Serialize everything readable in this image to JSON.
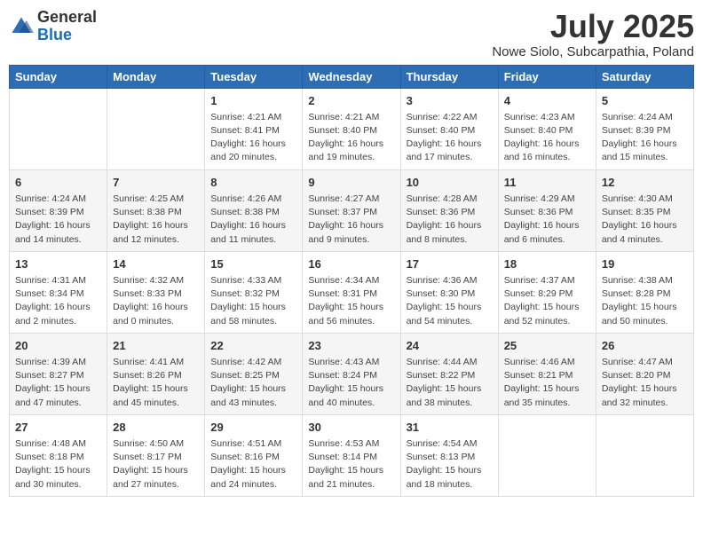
{
  "header": {
    "logo_general": "General",
    "logo_blue": "Blue",
    "month_title": "July 2025",
    "location": "Nowe Siolo, Subcarpathia, Poland"
  },
  "days_of_week": [
    "Sunday",
    "Monday",
    "Tuesday",
    "Wednesday",
    "Thursday",
    "Friday",
    "Saturday"
  ],
  "weeks": [
    [
      {
        "day": "",
        "info": ""
      },
      {
        "day": "",
        "info": ""
      },
      {
        "day": "1",
        "info": "Sunrise: 4:21 AM\nSunset: 8:41 PM\nDaylight: 16 hours and 20 minutes."
      },
      {
        "day": "2",
        "info": "Sunrise: 4:21 AM\nSunset: 8:40 PM\nDaylight: 16 hours and 19 minutes."
      },
      {
        "day": "3",
        "info": "Sunrise: 4:22 AM\nSunset: 8:40 PM\nDaylight: 16 hours and 17 minutes."
      },
      {
        "day": "4",
        "info": "Sunrise: 4:23 AM\nSunset: 8:40 PM\nDaylight: 16 hours and 16 minutes."
      },
      {
        "day": "5",
        "info": "Sunrise: 4:24 AM\nSunset: 8:39 PM\nDaylight: 16 hours and 15 minutes."
      }
    ],
    [
      {
        "day": "6",
        "info": "Sunrise: 4:24 AM\nSunset: 8:39 PM\nDaylight: 16 hours and 14 minutes."
      },
      {
        "day": "7",
        "info": "Sunrise: 4:25 AM\nSunset: 8:38 PM\nDaylight: 16 hours and 12 minutes."
      },
      {
        "day": "8",
        "info": "Sunrise: 4:26 AM\nSunset: 8:38 PM\nDaylight: 16 hours and 11 minutes."
      },
      {
        "day": "9",
        "info": "Sunrise: 4:27 AM\nSunset: 8:37 PM\nDaylight: 16 hours and 9 minutes."
      },
      {
        "day": "10",
        "info": "Sunrise: 4:28 AM\nSunset: 8:36 PM\nDaylight: 16 hours and 8 minutes."
      },
      {
        "day": "11",
        "info": "Sunrise: 4:29 AM\nSunset: 8:36 PM\nDaylight: 16 hours and 6 minutes."
      },
      {
        "day": "12",
        "info": "Sunrise: 4:30 AM\nSunset: 8:35 PM\nDaylight: 16 hours and 4 minutes."
      }
    ],
    [
      {
        "day": "13",
        "info": "Sunrise: 4:31 AM\nSunset: 8:34 PM\nDaylight: 16 hours and 2 minutes."
      },
      {
        "day": "14",
        "info": "Sunrise: 4:32 AM\nSunset: 8:33 PM\nDaylight: 16 hours and 0 minutes."
      },
      {
        "day": "15",
        "info": "Sunrise: 4:33 AM\nSunset: 8:32 PM\nDaylight: 15 hours and 58 minutes."
      },
      {
        "day": "16",
        "info": "Sunrise: 4:34 AM\nSunset: 8:31 PM\nDaylight: 15 hours and 56 minutes."
      },
      {
        "day": "17",
        "info": "Sunrise: 4:36 AM\nSunset: 8:30 PM\nDaylight: 15 hours and 54 minutes."
      },
      {
        "day": "18",
        "info": "Sunrise: 4:37 AM\nSunset: 8:29 PM\nDaylight: 15 hours and 52 minutes."
      },
      {
        "day": "19",
        "info": "Sunrise: 4:38 AM\nSunset: 8:28 PM\nDaylight: 15 hours and 50 minutes."
      }
    ],
    [
      {
        "day": "20",
        "info": "Sunrise: 4:39 AM\nSunset: 8:27 PM\nDaylight: 15 hours and 47 minutes."
      },
      {
        "day": "21",
        "info": "Sunrise: 4:41 AM\nSunset: 8:26 PM\nDaylight: 15 hours and 45 minutes."
      },
      {
        "day": "22",
        "info": "Sunrise: 4:42 AM\nSunset: 8:25 PM\nDaylight: 15 hours and 43 minutes."
      },
      {
        "day": "23",
        "info": "Sunrise: 4:43 AM\nSunset: 8:24 PM\nDaylight: 15 hours and 40 minutes."
      },
      {
        "day": "24",
        "info": "Sunrise: 4:44 AM\nSunset: 8:22 PM\nDaylight: 15 hours and 38 minutes."
      },
      {
        "day": "25",
        "info": "Sunrise: 4:46 AM\nSunset: 8:21 PM\nDaylight: 15 hours and 35 minutes."
      },
      {
        "day": "26",
        "info": "Sunrise: 4:47 AM\nSunset: 8:20 PM\nDaylight: 15 hours and 32 minutes."
      }
    ],
    [
      {
        "day": "27",
        "info": "Sunrise: 4:48 AM\nSunset: 8:18 PM\nDaylight: 15 hours and 30 minutes."
      },
      {
        "day": "28",
        "info": "Sunrise: 4:50 AM\nSunset: 8:17 PM\nDaylight: 15 hours and 27 minutes."
      },
      {
        "day": "29",
        "info": "Sunrise: 4:51 AM\nSunset: 8:16 PM\nDaylight: 15 hours and 24 minutes."
      },
      {
        "day": "30",
        "info": "Sunrise: 4:53 AM\nSunset: 8:14 PM\nDaylight: 15 hours and 21 minutes."
      },
      {
        "day": "31",
        "info": "Sunrise: 4:54 AM\nSunset: 8:13 PM\nDaylight: 15 hours and 18 minutes."
      },
      {
        "day": "",
        "info": ""
      },
      {
        "day": "",
        "info": ""
      }
    ]
  ]
}
